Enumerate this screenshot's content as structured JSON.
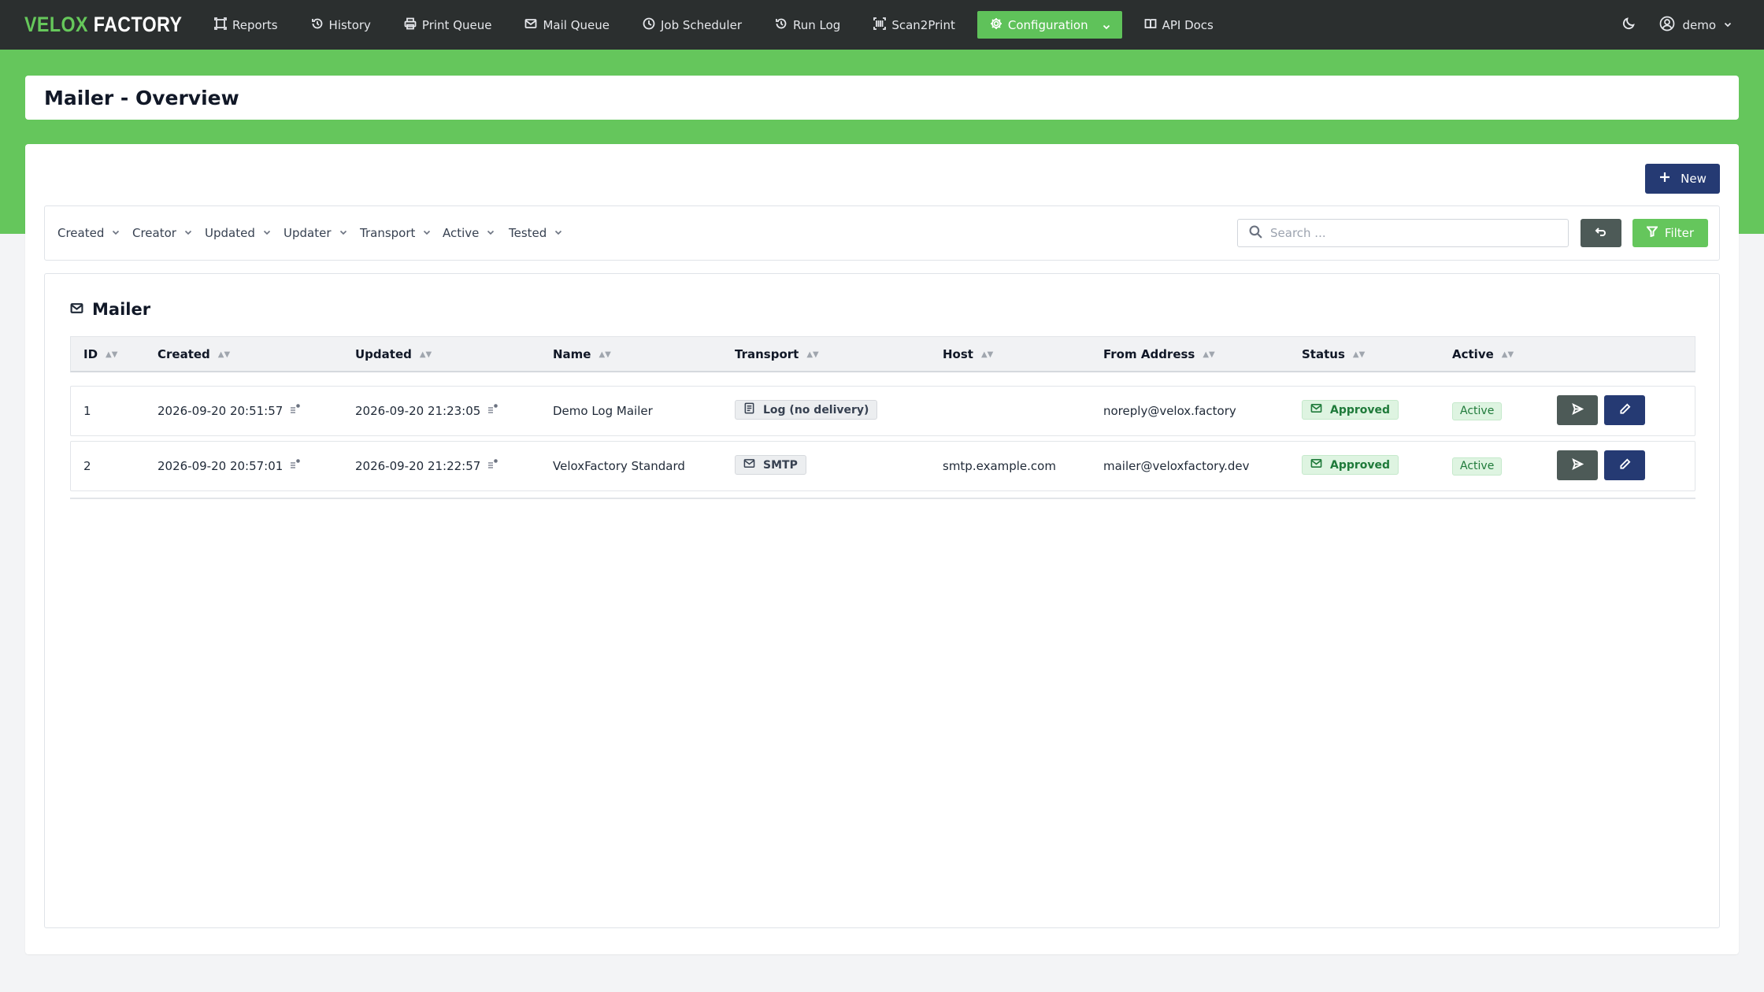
{
  "brand": {
    "part1": "VELOX",
    "part2": "FACTORY"
  },
  "nav": {
    "items": [
      {
        "label": "Reports",
        "icon": "reports-icon"
      },
      {
        "label": "History",
        "icon": "history-icon"
      },
      {
        "label": "Print Queue",
        "icon": "printer-icon"
      },
      {
        "label": "Mail Queue",
        "icon": "mail-queue-icon"
      },
      {
        "label": "Job Scheduler",
        "icon": "clock-icon"
      },
      {
        "label": "Run Log",
        "icon": "run-log-icon"
      },
      {
        "label": "Scan2Print",
        "icon": "scan-icon"
      },
      {
        "label": "Configuration",
        "icon": "gear-icon",
        "active": true
      },
      {
        "label": "API Docs",
        "icon": "book-icon"
      }
    ],
    "user": "demo"
  },
  "page": {
    "title": "Mailer - Overview"
  },
  "toolbar": {
    "new_label": "New",
    "filter_label": "Filter",
    "search_placeholder": "Search ..."
  },
  "filters": [
    "Created",
    "Creator",
    "Updated",
    "Updater",
    "Transport",
    "Active",
    "Tested"
  ],
  "panel": {
    "title": "Mailer"
  },
  "table": {
    "columns": [
      "ID",
      "Created",
      "Updated",
      "Name",
      "Transport",
      "Host",
      "From Address",
      "Status",
      "Active"
    ],
    "rows": [
      {
        "id": "1",
        "created": "2026-09-20 20:51:57",
        "updated": "2026-09-20 21:23:05",
        "name": "Demo Log Mailer",
        "transport": "Log (no delivery)",
        "transport_icon": "log-icon",
        "host": "",
        "from": "noreply@velox.factory",
        "status": "Approved",
        "active": "Active"
      },
      {
        "id": "2",
        "created": "2026-09-20 20:57:01",
        "updated": "2026-09-20 21:22:57",
        "name": "VeloxFactory Standard",
        "transport": "SMTP",
        "transport_icon": "envelope-icon",
        "host": "smtp.example.com",
        "from": "mailer@veloxfactory.dev",
        "status": "Approved",
        "active": "Active"
      }
    ]
  },
  "colors": {
    "navbar": "#2b2f2f",
    "brand_green": "#65c65c",
    "primary_blue": "#253a73",
    "secondary_gray": "#4d5a57",
    "approved_bg": "#def4e1",
    "approved_text": "#1f7a3a"
  }
}
